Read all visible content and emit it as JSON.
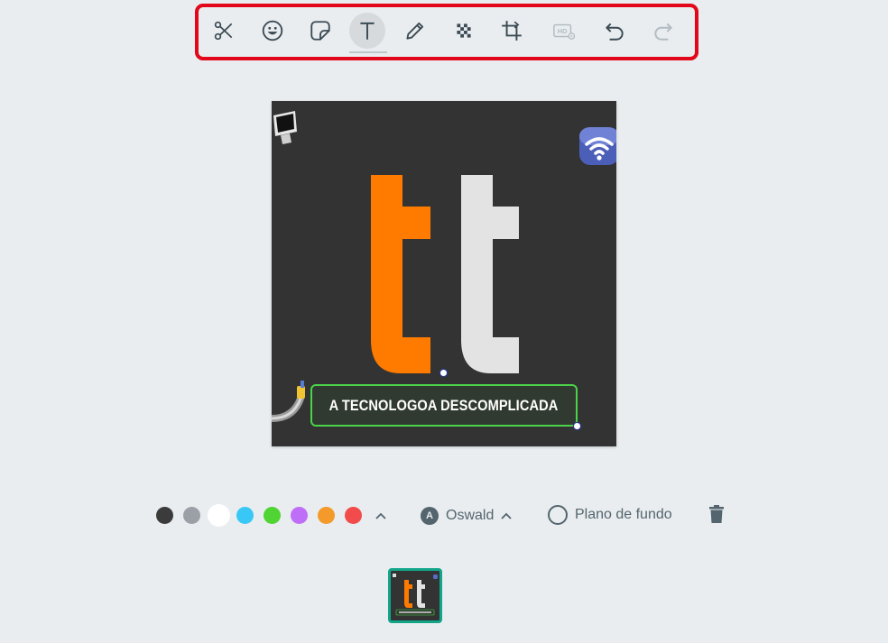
{
  "toolbar": {
    "tools": [
      {
        "icon": "scissors-icon",
        "label": ""
      },
      {
        "icon": "emoji-icon",
        "label": ""
      },
      {
        "icon": "sticker-icon",
        "label": ""
      },
      {
        "icon": "text-icon",
        "label": "",
        "active": true
      },
      {
        "icon": "pencil-icon",
        "label": ""
      },
      {
        "icon": "blur-icon",
        "label": ""
      },
      {
        "icon": "crop-icon",
        "label": ""
      },
      {
        "icon": "hd-icon",
        "label": "HD",
        "disabled": true
      },
      {
        "icon": "undo-icon",
        "label": ""
      },
      {
        "icon": "redo-icon",
        "label": "",
        "disabled": true
      }
    ]
  },
  "canvas": {
    "text_overlay": "A TECNOLOGOA DESCOMPLICADA",
    "letter_colors": {
      "first": "#ff7b00",
      "second": "#e3e3e3"
    },
    "stickers": [
      "computer-sticker",
      "wifi-sticker",
      "satellite-antenna-sticker"
    ]
  },
  "text_options": {
    "colors": [
      "#3b3b3b",
      "#9aa0a6",
      "#ffffff",
      "#39c8f5",
      "#4fd434",
      "#bf6ef7",
      "#f39a2b",
      "#f24b4b"
    ],
    "selected_color": "#ffffff",
    "font_badge": "A",
    "font_name": "Oswald",
    "background_label": "Plano de fundo"
  },
  "thumbnail": {
    "selected": true,
    "caption": "A TECNOLOGOA DESCOMPLICADA"
  },
  "colors": {
    "page_bg": "#e9edef",
    "highlight": "#e3071a",
    "accent": "#12a58a",
    "text_box_border": "#4bd34a"
  }
}
